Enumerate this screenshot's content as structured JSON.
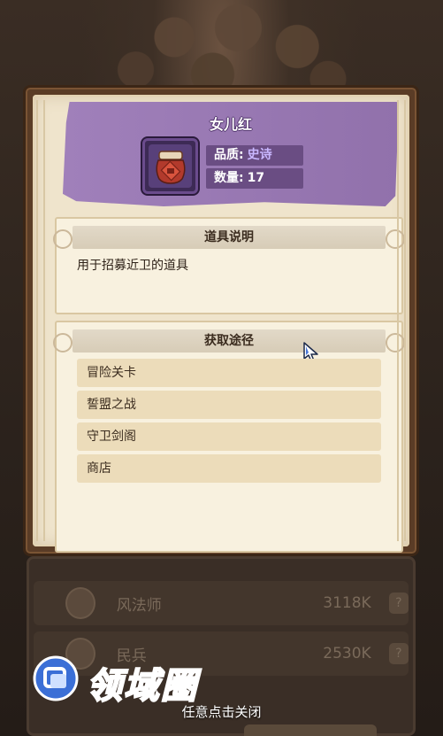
{
  "item": {
    "name": "女儿红",
    "quality_label": "品质:",
    "quality_value": "史诗",
    "count_label": "数量:",
    "count_value": "17"
  },
  "description": {
    "title": "道具说明",
    "text": "用于招募近卫的道具"
  },
  "sources": {
    "title": "获取途径",
    "items": [
      "冒险关卡",
      "誓盟之战",
      "守卫剑阁",
      "商店"
    ]
  },
  "background": {
    "rows": [
      {
        "name": "风法师",
        "power": "3118K"
      },
      {
        "name": "民兵",
        "power": "2530K"
      }
    ]
  },
  "close_hint": "任意点击关闭",
  "watermark": "领域圈",
  "colors": {
    "header_purple": "#9a78b6",
    "parchment": "#efe4cc",
    "epic_text": "#c9b7ff",
    "frame_brown": "#5a3c26"
  },
  "icons": {
    "item": "wine-jar-icon",
    "cursor": "pointer-cursor-icon"
  }
}
